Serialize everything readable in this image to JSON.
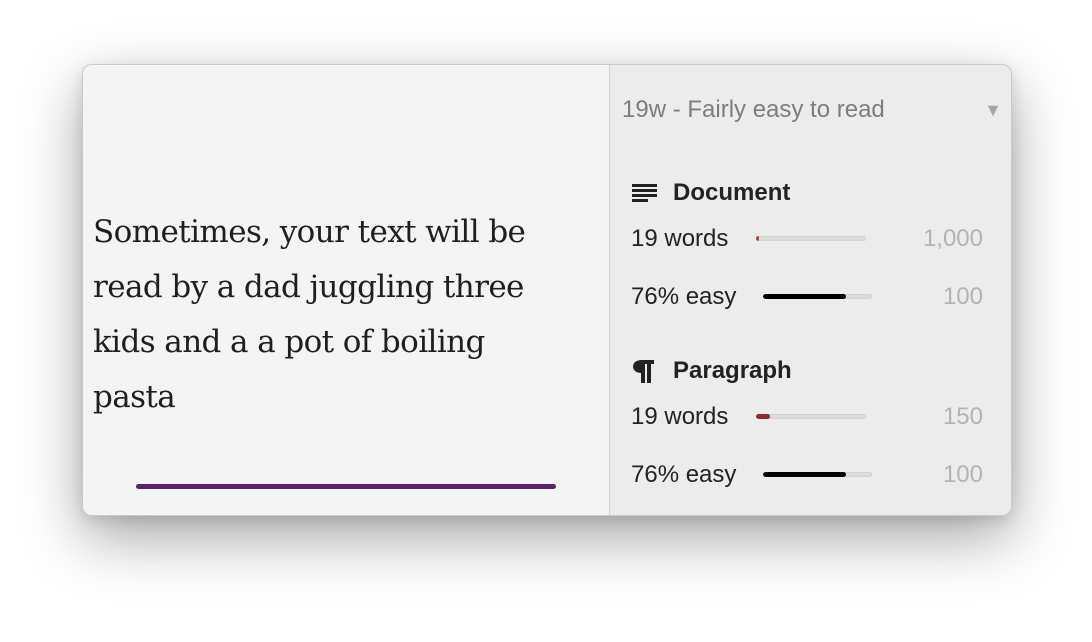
{
  "editor": {
    "text": "Sometimes, your text will be\nread by a dad juggling three\nkids and a a pot of boiling\npasta",
    "underline_color": "#5b2173"
  },
  "sidebar": {
    "summary": "19w - Fairly easy to read",
    "dropdown_arrow": "▼",
    "sections": [
      {
        "title": "Document",
        "icon": "document-lines-icon",
        "metrics": [
          {
            "label": "19 words",
            "target": "1,000",
            "progress": 0.019,
            "fill_color": "#c0392b"
          },
          {
            "label": "76% easy",
            "target": "100",
            "progress": 0.76,
            "fill_color": "#000000"
          }
        ]
      },
      {
        "title": "Paragraph",
        "icon": "pilcrow-icon",
        "metrics": [
          {
            "label": "19 words",
            "target": "150",
            "progress": 0.127,
            "fill_color": "#8e2a2a"
          },
          {
            "label": "76% easy",
            "target": "100",
            "progress": 0.76,
            "fill_color": "#000000"
          }
        ]
      }
    ]
  }
}
